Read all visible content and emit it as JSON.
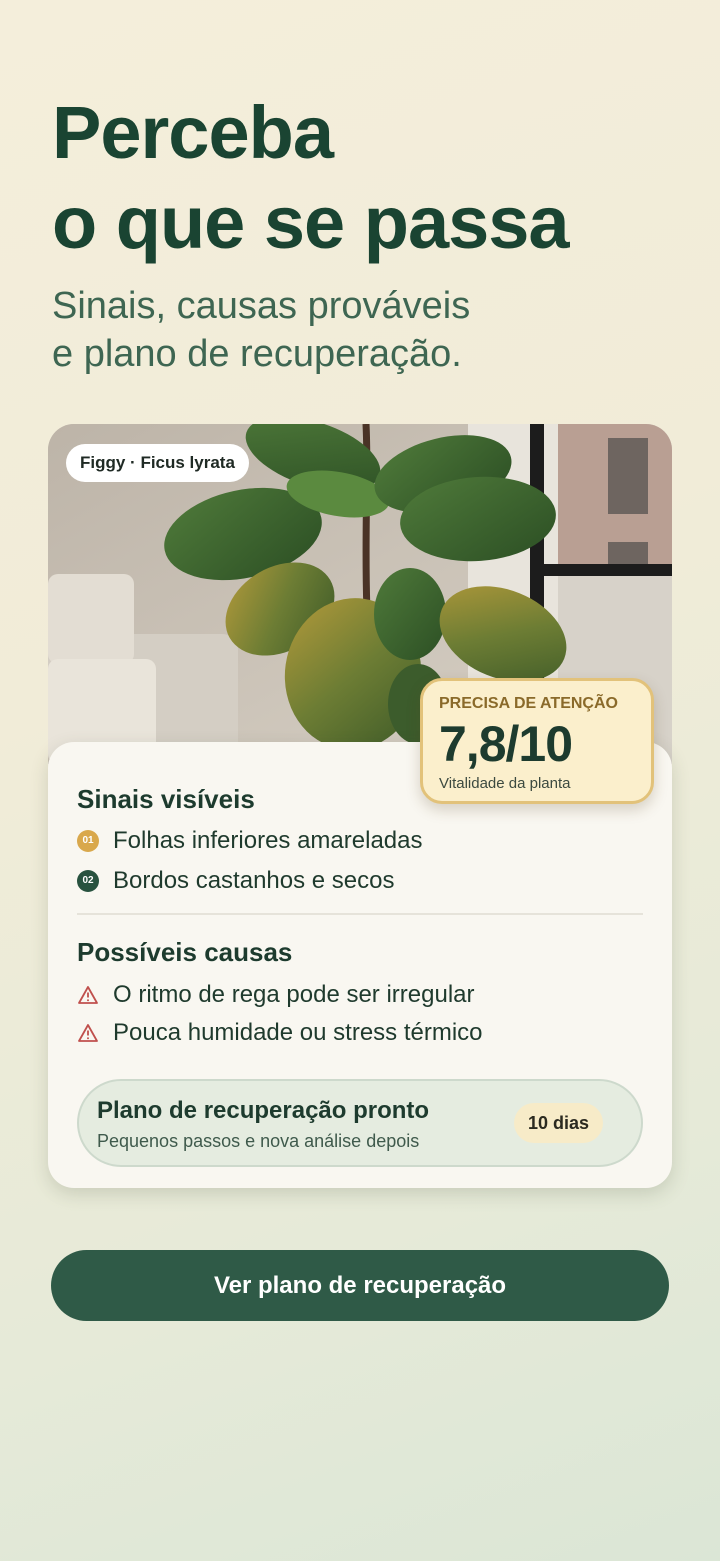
{
  "header": {
    "title_line1": "Perceba",
    "title_line2": "o que se passa",
    "subtitle_line1": "Sinais, causas prováveis",
    "subtitle_line2": "e plano de recuperação."
  },
  "plant": {
    "tag": "Figgy · Ficus lyrata"
  },
  "score": {
    "status": "PRECISA DE ATENÇÃO",
    "value": "7,8/10",
    "caption": "Vitalidade da planta",
    "level": 0.78
  },
  "signs": {
    "title": "Sinais visíveis",
    "items": [
      {
        "badge": "01",
        "text": "Folhas inferiores amareladas"
      },
      {
        "badge": "02",
        "text": "Bordos castanhos e secos"
      }
    ]
  },
  "causes": {
    "title": "Possíveis causas",
    "items": [
      {
        "text": "O ritmo de rega pode ser irregular"
      },
      {
        "text": "Pouca humidade ou stress térmico"
      }
    ]
  },
  "plan": {
    "title": "Plano de recuperação pronto",
    "subtitle": "Pequenos passos e nova análise depois",
    "duration": "10 dias"
  },
  "cta": {
    "label": "Ver plano de recuperação"
  },
  "colors": {
    "primary": "#2f5a47",
    "headline": "#1a4432",
    "warning": "#c0504d",
    "accent_gold": "#d9a84c"
  }
}
